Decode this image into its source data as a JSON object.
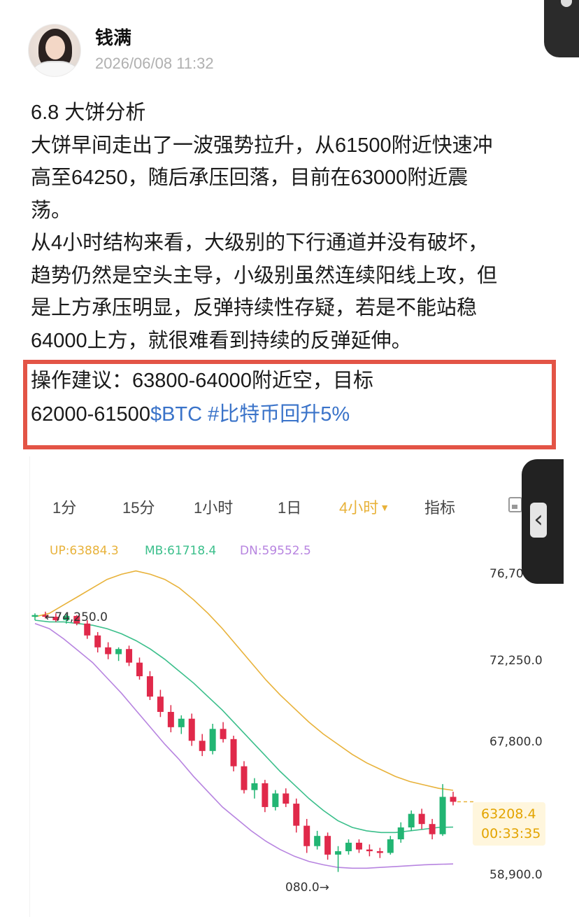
{
  "post": {
    "author": "钱满",
    "date": "2026/06/08 11:32",
    "lines": [
      "6.8 大饼分析",
      "大饼早间走出了一波强势拉升，从61500附近快速冲",
      "高至64250，随后承压回落，目前在63000附近震",
      "荡。",
      "从4小时结构来看，大级别的下行通道并没有破坏，",
      "趋势仍然是空头主导，小级别虽然连续阳线上攻，但",
      "是上方承压明显，反弹持续性存疑，若是不能站稳",
      "64000上方，就很难看到持续的反弹延伸。"
    ],
    "advice_line1": "操作建议：63800-64000附近空，目标",
    "advice_line2_text": "62000-61500",
    "advice_link1": "$BTC",
    "advice_link2": "#比特币回升5%"
  },
  "chart": {
    "tabs": [
      "1分",
      "15分",
      "1小时",
      "1日",
      "4小时",
      "指标"
    ],
    "active_tab": "4小时",
    "legend": {
      "up": "UP:63884.3",
      "mb": "MB:61718.4",
      "dn": "DN:59552.5"
    },
    "y_ticks": [
      "76,70",
      "72,250.0",
      "67,800.0",
      "58,900.0"
    ],
    "high_label": "74,250.0",
    "low_label": "080.0→",
    "last_price": "63208.4",
    "countdown": "00:33:35",
    "colors": {
      "up": "#e8b23a",
      "mb": "#3bbf8b",
      "dn": "#b784e0",
      "bull": "#22b573",
      "bear": "#e0294a"
    }
  },
  "chart_data": {
    "type": "candlestick",
    "series": [
      {
        "name": "UP",
        "values": [
          74100,
          74300,
          74800,
          75300,
          75800,
          76300,
          76600,
          76800,
          76600,
          76300,
          75800,
          75100,
          74300,
          73400,
          72400,
          71400,
          70400,
          69500,
          68700,
          67900,
          67200,
          66600,
          66000,
          65500,
          65100,
          64700,
          64400,
          64200,
          64000,
          63884.3
        ]
      },
      {
        "name": "MB",
        "values": [
          73900,
          73800,
          73800,
          73700,
          73600,
          73400,
          73100,
          72700,
          72200,
          71600,
          70900,
          70200,
          69400,
          68600,
          67700,
          66800,
          65900,
          65000,
          64200,
          63400,
          62700,
          62100,
          61700,
          61500,
          61400,
          61400,
          61500,
          61600,
          61700,
          61718.4
        ]
      },
      {
        "name": "DN",
        "values": [
          73700,
          73400,
          72800,
          72100,
          71400,
          70500,
          69600,
          68600,
          67600,
          66600,
          65700,
          64700,
          63800,
          62900,
          62200,
          61500,
          60900,
          60400,
          60000,
          59700,
          59500,
          59350,
          59300,
          59300,
          59350,
          59400,
          59450,
          59500,
          59530,
          59552.5
        ]
      }
    ],
    "candles_ohlc": [
      [
        74100,
        74300,
        73900,
        74200
      ],
      [
        74200,
        74400,
        74000,
        74100
      ],
      [
        74100,
        74300,
        73800,
        73900
      ],
      [
        73900,
        74250,
        73700,
        74150
      ],
      [
        74150,
        74200,
        73600,
        73700
      ],
      [
        73700,
        73900,
        72800,
        73000
      ],
      [
        73000,
        73200,
        72000,
        72300
      ],
      [
        72300,
        72600,
        71600,
        71900
      ],
      [
        71900,
        72300,
        71500,
        72200
      ],
      [
        72200,
        72400,
        71200,
        71400
      ],
      [
        71400,
        71700,
        70400,
        70600
      ],
      [
        70600,
        70900,
        69200,
        69400
      ],
      [
        69400,
        69800,
        68200,
        68500
      ],
      [
        68500,
        68900,
        67300,
        67600
      ],
      [
        67600,
        68300,
        67200,
        68100
      ],
      [
        68100,
        68400,
        66500,
        66800
      ],
      [
        66800,
        67200,
        65900,
        66200
      ],
      [
        66200,
        67800,
        66000,
        67500
      ],
      [
        67500,
        67900,
        66700,
        66900
      ],
      [
        66900,
        67100,
        65000,
        65300
      ],
      [
        65300,
        65600,
        63700,
        63900
      ],
      [
        63900,
        64600,
        63400,
        64300
      ],
      [
        64300,
        64500,
        62600,
        62900
      ],
      [
        62900,
        63900,
        62700,
        63700
      ],
      [
        63700,
        64000,
        62900,
        63100
      ],
      [
        63100,
        63400,
        61400,
        61800
      ],
      [
        61800,
        62200,
        60200,
        60600
      ],
      [
        60600,
        61500,
        60400,
        61200
      ],
      [
        61200,
        61400,
        59800,
        60100
      ],
      [
        60100,
        60600,
        59080,
        60300
      ],
      [
        60300,
        61000,
        60100,
        60800
      ],
      [
        60800,
        61000,
        60200,
        60400
      ],
      [
        60400,
        60700,
        60000,
        60300
      ],
      [
        60300,
        60500,
        59900,
        60200
      ],
      [
        60200,
        61200,
        60100,
        61000
      ],
      [
        61000,
        62000,
        60800,
        61700
      ],
      [
        61700,
        62700,
        61500,
        62500
      ],
      [
        62500,
        62800,
        61600,
        61900
      ],
      [
        61900,
        62200,
        61000,
        61300
      ],
      [
        61300,
        64250,
        61200,
        63500
      ],
      [
        63500,
        63800,
        63000,
        63208.4
      ]
    ],
    "ylim": [
      58900,
      76700
    ],
    "high": 74250.0,
    "low": 59080.0,
    "last": 63208.4
  }
}
